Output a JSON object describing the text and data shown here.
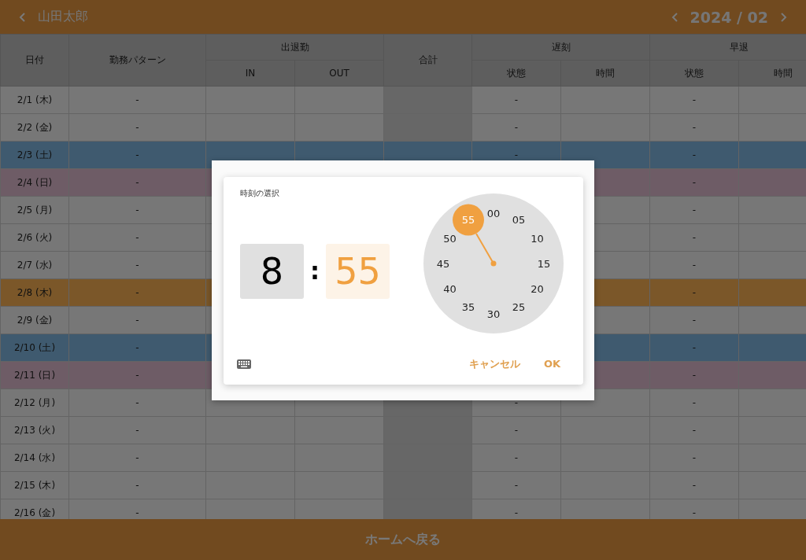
{
  "header": {
    "name": "山田太郎",
    "month": "2024 / 02"
  },
  "table": {
    "columns": [
      {
        "label": "日付"
      },
      {
        "label": "勤務パターン"
      },
      {
        "label": "出退勤",
        "children": [
          {
            "label": "IN"
          },
          {
            "label": "OUT"
          }
        ]
      },
      {
        "label": "合計"
      },
      {
        "label": "遅刻",
        "children": [
          {
            "label": "状態"
          },
          {
            "label": "時間"
          }
        ]
      },
      {
        "label": "早退",
        "children": [
          {
            "label": "状態"
          },
          {
            "label": "時間"
          }
        ]
      }
    ],
    "rows": [
      {
        "kind": "weekday",
        "date": "2/1 (木)",
        "pattern": "-",
        "late_status": "-",
        "early_status": "-"
      },
      {
        "kind": "weekday",
        "date": "2/2 (金)",
        "pattern": "-",
        "late_status": "-",
        "early_status": "-"
      },
      {
        "kind": "saturday",
        "date": "2/3 (土)",
        "pattern": "-",
        "late_status": "-",
        "early_status": "-"
      },
      {
        "kind": "sunday",
        "date": "2/4 (日)",
        "pattern": "-",
        "early_status": "-"
      },
      {
        "kind": "weekday",
        "date": "2/5 (月)",
        "pattern": "-",
        "early_status": "-"
      },
      {
        "kind": "weekday",
        "date": "2/6 (火)",
        "pattern": "-",
        "early_status": "-"
      },
      {
        "kind": "weekday",
        "date": "2/7 (水)",
        "pattern": "-",
        "early_status": "-"
      },
      {
        "kind": "highlight",
        "date": "2/8 (木)",
        "pattern": "-",
        "early_status": "-"
      },
      {
        "kind": "weekday",
        "date": "2/9 (金)",
        "pattern": "-",
        "early_status": "-"
      },
      {
        "kind": "saturday",
        "date": "2/10 (土)",
        "pattern": "-",
        "early_status": "-"
      },
      {
        "kind": "sunday",
        "date": "2/11 (日)",
        "pattern": "-",
        "early_status": "-"
      },
      {
        "kind": "weekday",
        "date": "2/12 (月)",
        "pattern": "-",
        "late_status": "-",
        "early_status": "-"
      },
      {
        "kind": "weekday",
        "date": "2/13 (火)",
        "pattern": "-",
        "late_status": "-",
        "early_status": "-"
      },
      {
        "kind": "weekday",
        "date": "2/14 (水)",
        "pattern": "-",
        "late_status": "-",
        "early_status": "-"
      },
      {
        "kind": "weekday",
        "date": "2/15 (木)",
        "pattern": "-",
        "late_status": "-",
        "early_status": "-"
      },
      {
        "kind": "weekday",
        "date": "2/16 (金)",
        "pattern": "-",
        "late_status": "-",
        "early_status": "-"
      }
    ]
  },
  "footer": {
    "button": "ホームへ戻る"
  },
  "dialog": {
    "title": "時刻の選択",
    "hour": {
      "value": "8",
      "selected": false
    },
    "separator": ":",
    "minute": {
      "value": "55",
      "selected": true
    },
    "clock": [
      {
        "label": "00",
        "selected": false
      },
      {
        "label": "05",
        "selected": false
      },
      {
        "label": "10",
        "selected": false
      },
      {
        "label": "15",
        "selected": false
      },
      {
        "label": "20",
        "selected": false
      },
      {
        "label": "25",
        "selected": false
      },
      {
        "label": "30",
        "selected": false
      },
      {
        "label": "35",
        "selected": false
      },
      {
        "label": "40",
        "selected": false
      },
      {
        "label": "45",
        "selected": false
      },
      {
        "label": "50",
        "selected": false
      },
      {
        "label": "55",
        "selected": true
      }
    ],
    "buttons": [
      "キャンセル",
      "OK"
    ]
  }
}
